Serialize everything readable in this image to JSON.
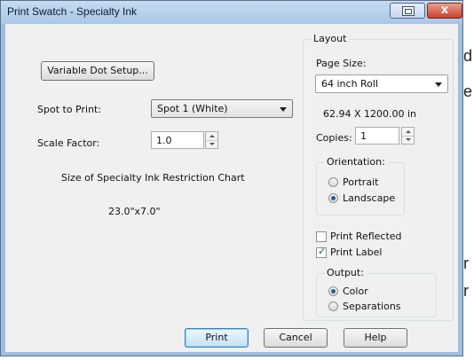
{
  "background_text": {
    "line1": "d",
    "line2": "e",
    "line3": "r",
    "line4": "r"
  },
  "window": {
    "title": "Print Swatch - Specialty Ink",
    "close_glyph": "x"
  },
  "left": {
    "variable_dot_button": "Variable Dot Setup...",
    "spot_label": "Spot to Print:",
    "spot_value": "Spot 1 (White)",
    "scale_label": "Scale Factor:",
    "scale_value": "1.0",
    "chart_size_label": "Size of Specialty Ink Restriction Chart",
    "chart_size_value": "23.0\"x7.0\""
  },
  "layout": {
    "group_title": "Layout",
    "page_size_label": "Page Size:",
    "page_size_value": "64 inch Roll",
    "dimensions": "62.94 X 1200.00  in",
    "copies_label": "Copies:",
    "copies_value": "1",
    "orientation": {
      "title": "Orientation:",
      "options": [
        "Portrait",
        "Landscape"
      ],
      "selected": "Landscape"
    },
    "print_reflected": {
      "label": "Print Reflected",
      "checked": false
    },
    "print_label": {
      "label": "Print Label",
      "checked": true
    },
    "output": {
      "title": "Output:",
      "options": [
        "Color",
        "Separations"
      ],
      "selected": "Color"
    }
  },
  "footer": {
    "print": "Print",
    "cancel": "Cancel",
    "help": "Help"
  }
}
